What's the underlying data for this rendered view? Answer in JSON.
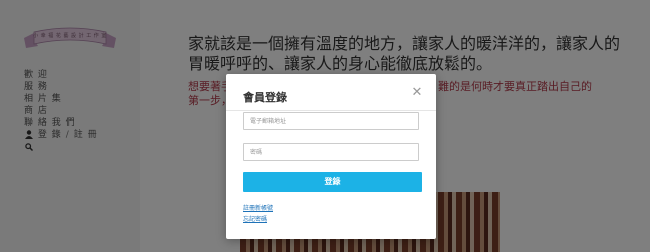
{
  "site": {
    "logo_text": "小 幸 福 花 藝 設 計 工 作 室"
  },
  "sidebar": {
    "items": [
      {
        "label": "歡 迎"
      },
      {
        "label": "服 務"
      },
      {
        "label": "相 片 集"
      },
      {
        "label": "商 店"
      },
      {
        "label": "聯 絡 我 們"
      }
    ],
    "login_label": "登 錄",
    "separator": "/",
    "register_label": "註 冊",
    "user_icon": "user-icon",
    "search_icon": "search-icon"
  },
  "main": {
    "headline": "家就該是一個擁有溫度的地方，讓家人的暖洋洋的，讓家人的胃暖呼呼的、讓家人的身心能徹底放鬆的。",
    "subline_left": "想要著手",
    "subline_right": "難；難的是何時才要真正踏出自己的",
    "subline_left2": "第一步，"
  },
  "modal": {
    "title": "會員登錄",
    "close_icon": "close-icon",
    "email_placeholder": "電子郵箱地址",
    "password_placeholder": "密碼",
    "login_button": "登錄",
    "register_link": "註冊新帳號",
    "forgot_link": "忘記密碼"
  },
  "colors": {
    "accent": "#1cb2e6",
    "link": "#1e72b8",
    "subline": "#b33a4a"
  }
}
